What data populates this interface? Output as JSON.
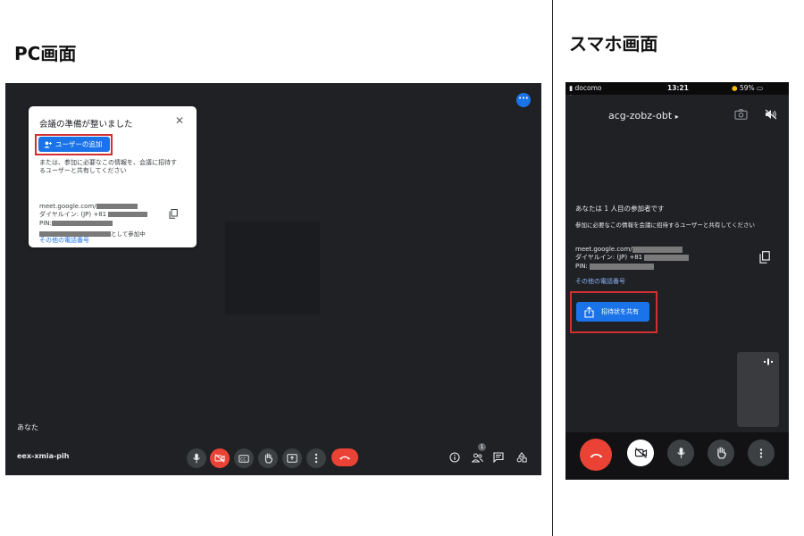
{
  "headings": {
    "pc": "PC画面",
    "smartphone": "スマホ画面"
  },
  "pc": {
    "card": {
      "title": "会議の準備が整いました",
      "add_button": "ユーザーの追加",
      "description": "または、参加に必要なこの情報を、会議に招待するユーザーと共有してください",
      "meet_url_prefix": "meet.google.com/",
      "dial_in": "ダイヤルイン: (JP) +81",
      "pin_label": "PIN:",
      "other_numbers_link": "その他の電話番号",
      "joined_as_suffix": "として参加中"
    },
    "participant_label": "あなた",
    "meeting_code": "eex-xmia-pih",
    "participants_count": "1",
    "colors": {
      "accent": "#1a73e8",
      "danger": "#ea4335",
      "highlight": "#d32f2f"
    }
  },
  "smartphone": {
    "status": {
      "carrier": "docomo",
      "time": "13:21",
      "battery": "59%"
    },
    "room_name": "acg-zobz-obt",
    "participant_count_text": "あなたは 1 人目の参加者です",
    "share_info_text": "参加に必要なこの情報を会議に招待するユーザーと共有してください",
    "meet_url_prefix": "meet.google.com/",
    "dial_in": "ダイヤルイン: (JP) +81",
    "pin_label": "PIN:",
    "other_numbers_link": "その他の電話番号",
    "share_button": "招待状を共有"
  }
}
